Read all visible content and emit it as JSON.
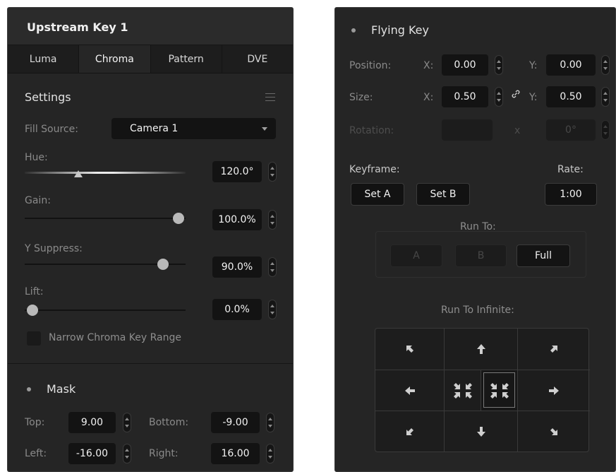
{
  "upstream_key": {
    "title": "Upstream Key 1",
    "tabs": [
      "Luma",
      "Chroma",
      "Pattern",
      "DVE"
    ],
    "active_tab": "Chroma",
    "settings": {
      "heading": "Settings",
      "menu_icon": "hamburger-menu-icon",
      "fill_source_label": "Fill Source:",
      "fill_source_value": "Camera 1",
      "hue_label": "Hue:",
      "hue_value": "120.0°",
      "gain_label": "Gain:",
      "gain_value": "100.0%",
      "y_suppress_label": "Y Suppress:",
      "y_suppress_value": "90.0%",
      "lift_label": "Lift:",
      "lift_value": "0.0%",
      "narrow_range_label": "Narrow Chroma Key Range"
    },
    "mask": {
      "heading": "Mask",
      "top_label": "Top:",
      "top_value": "9.00",
      "bottom_label": "Bottom:",
      "bottom_value": "-9.00",
      "left_label": "Left:",
      "left_value": "-16.00",
      "right_label": "Right:",
      "right_value": "16.00"
    }
  },
  "flying_key": {
    "title": "Flying Key",
    "position_label": "Position:",
    "size_label": "Size:",
    "rotation_label": "Rotation:",
    "x_label": "X:",
    "y_label": "Y:",
    "x_small_label": "x",
    "position_x": "0.00",
    "position_y": "0.00",
    "size_x": "0.50",
    "size_y": "0.50",
    "rotation_value": "0°",
    "keyframe_label": "Keyframe:",
    "set_a_label": "Set A",
    "set_b_label": "Set B",
    "rate_label": "Rate:",
    "rate_value": "1:00",
    "run_to_label": "Run To:",
    "run_to_buttons": [
      "A",
      "B",
      "Full"
    ],
    "run_to_infinite_label": "Run To Infinite:",
    "direction_icons": [
      "arrow-up-left-icon",
      "arrow-up-icon",
      "arrow-up-right-icon",
      "arrow-left-icon",
      "shrink-center-icon",
      "shrink-center-selected-icon",
      "arrow-right-icon",
      "arrow-down-left-icon",
      "arrow-down-icon",
      "arrow-down-right-icon"
    ]
  },
  "colors": {
    "panel_bg": "#252525",
    "field_bg": "#131313",
    "border": "#3a3a3a",
    "text": "#f2f2f2",
    "label": "#8a8a8a",
    "dimmed": "#474747"
  }
}
